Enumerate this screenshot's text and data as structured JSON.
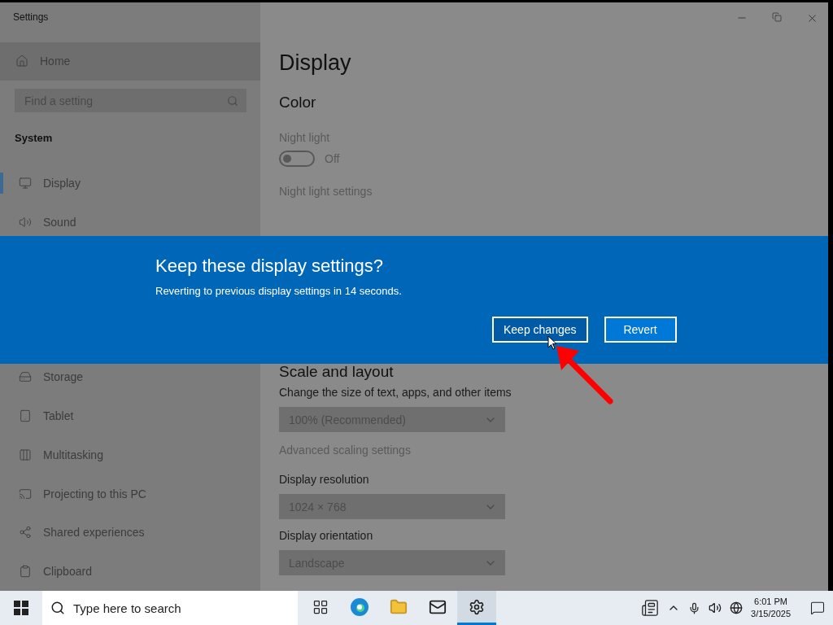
{
  "window": {
    "title": "Settings"
  },
  "sidebar": {
    "home": "Home",
    "search": {
      "placeholder": "Find a setting"
    },
    "section": "System",
    "items_top": [
      {
        "label": "Display",
        "selected": true
      },
      {
        "label": "Sound",
        "selected": false
      }
    ],
    "items_bottom": [
      {
        "label": "Storage",
        "selected": false
      },
      {
        "label": "Tablet",
        "selected": false
      },
      {
        "label": "Multitasking",
        "selected": false
      },
      {
        "label": "Projecting to this PC",
        "selected": false
      },
      {
        "label": "Shared experiences",
        "selected": false
      },
      {
        "label": "Clipboard",
        "selected": false
      }
    ]
  },
  "main": {
    "title": "Display",
    "color_section": {
      "heading": "Color",
      "toggle": {
        "label": "Night light",
        "on": false,
        "state_text": "Off"
      },
      "link": "Night light settings"
    },
    "scale_section": {
      "heading": "Scale and layout",
      "fields": [
        {
          "label": "Change the size of text, apps, and other items",
          "value": "100% (Recommended)"
        },
        {
          "label": "Display resolution",
          "value": "1024 × 768"
        },
        {
          "label": "Display orientation",
          "value": "Landscape"
        }
      ],
      "link": "Advanced scaling settings"
    }
  },
  "dialog": {
    "title": "Keep these display settings?",
    "message": "Reverting to previous display settings in 14 seconds.",
    "buttons": [
      {
        "label": "Keep changes",
        "hovered": true
      },
      {
        "label": "Revert",
        "hovered": false
      }
    ]
  },
  "taskbar": {
    "search": {
      "placeholder": "Type here to search"
    },
    "apps": [
      {
        "kind": "taskview",
        "active": false
      },
      {
        "kind": "edge",
        "active": false
      },
      {
        "kind": "files",
        "active": false
      },
      {
        "kind": "mail",
        "active": false
      },
      {
        "kind": "settings",
        "active": true
      }
    ],
    "clock": {
      "time": "6:01 PM",
      "date": "3/15/2025"
    }
  }
}
